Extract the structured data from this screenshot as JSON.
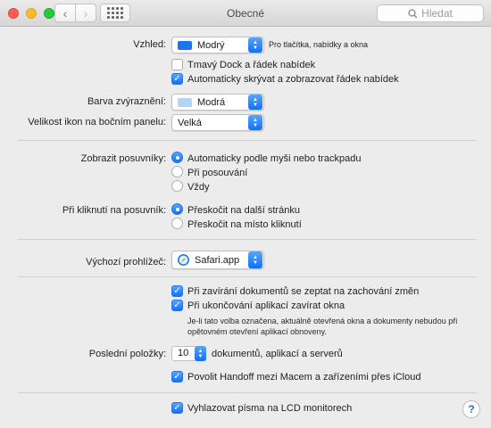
{
  "window": {
    "title": "Obecné",
    "search_placeholder": "Hledat"
  },
  "appearance": {
    "label": "Vzhled:",
    "value": "Modrý",
    "note": "Pro tlačítka, nabídky a okna",
    "dark_dock_label": "Tmavý Dock a řádek nabídek",
    "dark_dock_checked": false,
    "autohide_menu_label": "Automaticky skrývat a zobrazovat řádek nabídek",
    "autohide_menu_checked": true
  },
  "highlight": {
    "label": "Barva zvýraznění:",
    "value": "Modrá",
    "swatch": "#b3d4f7"
  },
  "sidebar_icon_size": {
    "label": "Velikost ikon na bočním panelu:",
    "value": "Velká"
  },
  "scrollbars": {
    "label": "Zobrazit posuvníky:",
    "options": [
      "Automaticky podle myši nebo trackpadu",
      "Při posouvání",
      "Vždy"
    ],
    "selected": 0
  },
  "scrollbar_click": {
    "label": "Při kliknutí na posuvník:",
    "options": [
      "Přeskočit na další stránku",
      "Přeskočit na místo kliknutí"
    ],
    "selected": 0
  },
  "default_browser": {
    "label": "Výchozí prohlížeč:",
    "value": "Safari.app"
  },
  "documents": {
    "ask_save_label": "Při zavírání dokumentů se zeptat na zachování změn",
    "ask_save_checked": true,
    "close_windows_label": "Při ukončování aplikací zavírat okna",
    "close_windows_checked": true,
    "note_line1": "Je-li tato volba označena, aktuálně otevřená okna a dokumenty nebudou při",
    "note_line2": "opětovném otevření aplikací obnoveny."
  },
  "recent_items": {
    "label": "Poslední položky:",
    "value": "10",
    "suffix": "dokumentů, aplikací a serverů",
    "handoff_label": "Povolit Handoff mezi Macem a zařízeními přes iCloud",
    "handoff_checked": true
  },
  "lcd": {
    "label": "Vyhlazovat písma na LCD monitorech",
    "checked": true
  },
  "help_label": "?",
  "colors": {
    "accent": "#1470f4",
    "appearance_swatch": "#1a74f0"
  }
}
